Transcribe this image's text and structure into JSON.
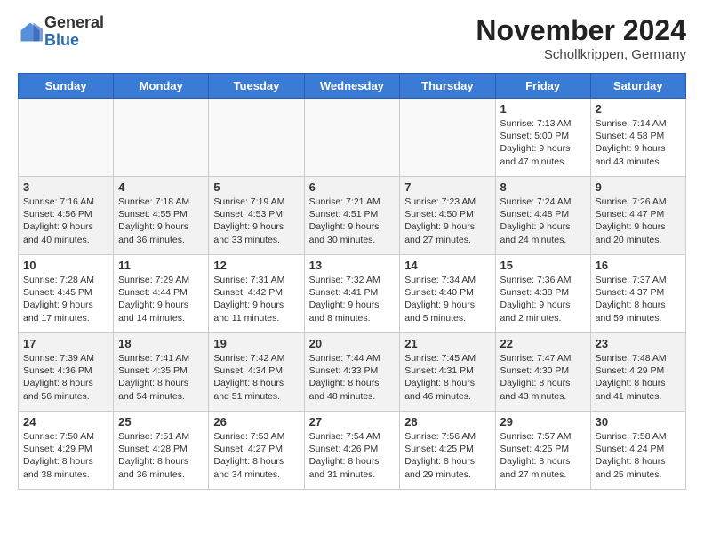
{
  "logo": {
    "general": "General",
    "blue": "Blue"
  },
  "title": "November 2024",
  "subtitle": "Schollkrippen, Germany",
  "days_of_week": [
    "Sunday",
    "Monday",
    "Tuesday",
    "Wednesday",
    "Thursday",
    "Friday",
    "Saturday"
  ],
  "weeks": [
    [
      {
        "day": "",
        "info": ""
      },
      {
        "day": "",
        "info": ""
      },
      {
        "day": "",
        "info": ""
      },
      {
        "day": "",
        "info": ""
      },
      {
        "day": "",
        "info": ""
      },
      {
        "day": "1",
        "info": "Sunrise: 7:13 AM\nSunset: 5:00 PM\nDaylight: 9 hours and 47 minutes."
      },
      {
        "day": "2",
        "info": "Sunrise: 7:14 AM\nSunset: 4:58 PM\nDaylight: 9 hours and 43 minutes."
      }
    ],
    [
      {
        "day": "3",
        "info": "Sunrise: 7:16 AM\nSunset: 4:56 PM\nDaylight: 9 hours and 40 minutes."
      },
      {
        "day": "4",
        "info": "Sunrise: 7:18 AM\nSunset: 4:55 PM\nDaylight: 9 hours and 36 minutes."
      },
      {
        "day": "5",
        "info": "Sunrise: 7:19 AM\nSunset: 4:53 PM\nDaylight: 9 hours and 33 minutes."
      },
      {
        "day": "6",
        "info": "Sunrise: 7:21 AM\nSunset: 4:51 PM\nDaylight: 9 hours and 30 minutes."
      },
      {
        "day": "7",
        "info": "Sunrise: 7:23 AM\nSunset: 4:50 PM\nDaylight: 9 hours and 27 minutes."
      },
      {
        "day": "8",
        "info": "Sunrise: 7:24 AM\nSunset: 4:48 PM\nDaylight: 9 hours and 24 minutes."
      },
      {
        "day": "9",
        "info": "Sunrise: 7:26 AM\nSunset: 4:47 PM\nDaylight: 9 hours and 20 minutes."
      }
    ],
    [
      {
        "day": "10",
        "info": "Sunrise: 7:28 AM\nSunset: 4:45 PM\nDaylight: 9 hours and 17 minutes."
      },
      {
        "day": "11",
        "info": "Sunrise: 7:29 AM\nSunset: 4:44 PM\nDaylight: 9 hours and 14 minutes."
      },
      {
        "day": "12",
        "info": "Sunrise: 7:31 AM\nSunset: 4:42 PM\nDaylight: 9 hours and 11 minutes."
      },
      {
        "day": "13",
        "info": "Sunrise: 7:32 AM\nSunset: 4:41 PM\nDaylight: 9 hours and 8 minutes."
      },
      {
        "day": "14",
        "info": "Sunrise: 7:34 AM\nSunset: 4:40 PM\nDaylight: 9 hours and 5 minutes."
      },
      {
        "day": "15",
        "info": "Sunrise: 7:36 AM\nSunset: 4:38 PM\nDaylight: 9 hours and 2 minutes."
      },
      {
        "day": "16",
        "info": "Sunrise: 7:37 AM\nSunset: 4:37 PM\nDaylight: 8 hours and 59 minutes."
      }
    ],
    [
      {
        "day": "17",
        "info": "Sunrise: 7:39 AM\nSunset: 4:36 PM\nDaylight: 8 hours and 56 minutes."
      },
      {
        "day": "18",
        "info": "Sunrise: 7:41 AM\nSunset: 4:35 PM\nDaylight: 8 hours and 54 minutes."
      },
      {
        "day": "19",
        "info": "Sunrise: 7:42 AM\nSunset: 4:34 PM\nDaylight: 8 hours and 51 minutes."
      },
      {
        "day": "20",
        "info": "Sunrise: 7:44 AM\nSunset: 4:33 PM\nDaylight: 8 hours and 48 minutes."
      },
      {
        "day": "21",
        "info": "Sunrise: 7:45 AM\nSunset: 4:31 PM\nDaylight: 8 hours and 46 minutes."
      },
      {
        "day": "22",
        "info": "Sunrise: 7:47 AM\nSunset: 4:30 PM\nDaylight: 8 hours and 43 minutes."
      },
      {
        "day": "23",
        "info": "Sunrise: 7:48 AM\nSunset: 4:29 PM\nDaylight: 8 hours and 41 minutes."
      }
    ],
    [
      {
        "day": "24",
        "info": "Sunrise: 7:50 AM\nSunset: 4:29 PM\nDaylight: 8 hours and 38 minutes."
      },
      {
        "day": "25",
        "info": "Sunrise: 7:51 AM\nSunset: 4:28 PM\nDaylight: 8 hours and 36 minutes."
      },
      {
        "day": "26",
        "info": "Sunrise: 7:53 AM\nSunset: 4:27 PM\nDaylight: 8 hours and 34 minutes."
      },
      {
        "day": "27",
        "info": "Sunrise: 7:54 AM\nSunset: 4:26 PM\nDaylight: 8 hours and 31 minutes."
      },
      {
        "day": "28",
        "info": "Sunrise: 7:56 AM\nSunset: 4:25 PM\nDaylight: 8 hours and 29 minutes."
      },
      {
        "day": "29",
        "info": "Sunrise: 7:57 AM\nSunset: 4:25 PM\nDaylight: 8 hours and 27 minutes."
      },
      {
        "day": "30",
        "info": "Sunrise: 7:58 AM\nSunset: 4:24 PM\nDaylight: 8 hours and 25 minutes."
      }
    ]
  ]
}
